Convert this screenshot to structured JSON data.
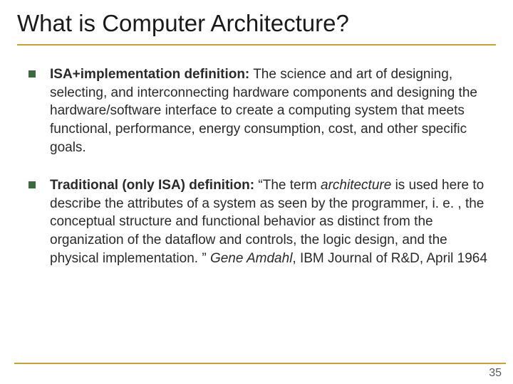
{
  "title": "What is Computer Architecture?",
  "bullets": [
    {
      "lead": "ISA+implementation definition:",
      "rest": " The science and art of designing, selecting, and interconnecting hardware components and designing the hardware/software interface to create a computing system that meets functional, performance, energy consumption, cost, and other specific goals."
    },
    {
      "lead": "Traditional (only ISA) definition:",
      "q1": " “The term ",
      "arch": "architecture",
      "q2": " is used here to describe the attributes of a system as seen by the programmer, i. e. , the conceptual structure and functional behavior as distinct from the organization of the dataflow and controls, the logic design, and the physical implementation. ” ",
      "author": "Gene Amdahl",
      "tail": ", IBM Journal of R&D, April 1964"
    }
  ],
  "pageNumber": "35"
}
